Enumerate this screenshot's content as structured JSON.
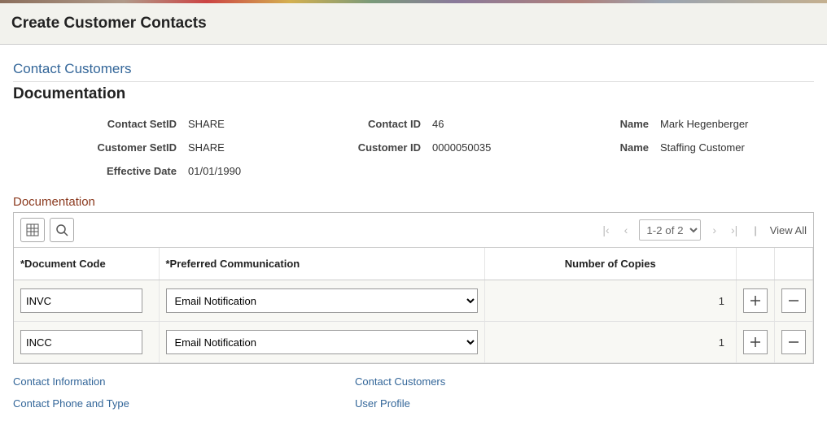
{
  "page_title": "Create Customer Contacts",
  "breadcrumb": "Contact Customers",
  "section_title": "Documentation",
  "info": {
    "contact_setid": {
      "label": "Contact SetID",
      "value": "SHARE"
    },
    "contact_id": {
      "label": "Contact ID",
      "value": "46"
    },
    "contact_name": {
      "label": "Name",
      "value": "Mark Hegenberger"
    },
    "customer_setid": {
      "label": "Customer SetID",
      "value": "SHARE"
    },
    "customer_id": {
      "label": "Customer ID",
      "value": "0000050035"
    },
    "customer_name": {
      "label": "Name",
      "value": "Staffing Customer"
    },
    "effective_date": {
      "label": "Effective Date",
      "value": "01/01/1990"
    }
  },
  "grid": {
    "title": "Documentation",
    "pager_text": "1-2 of 2",
    "view_all": "View All",
    "columns": {
      "doc_code": "*Document Code",
      "pref_comm": "*Preferred Communication",
      "num_copies": "Number of Copies"
    },
    "rows": [
      {
        "doc_code": "INVC",
        "pref_comm": "Email Notification",
        "num_copies": "1"
      },
      {
        "doc_code": "INCC",
        "pref_comm": "Email Notification",
        "num_copies": "1"
      }
    ]
  },
  "links": {
    "contact_info": "Contact Information",
    "contact_customers": "Contact Customers",
    "contact_phone": "Contact Phone and Type",
    "user_profile": "User Profile"
  }
}
